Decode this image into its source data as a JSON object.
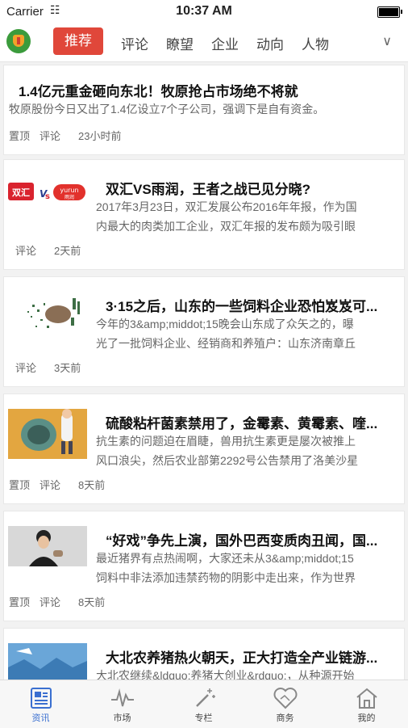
{
  "status": {
    "carrier": "Carrier",
    "time": "10:37 AM"
  },
  "nav": {
    "tabs": [
      {
        "label": "推荐"
      },
      {
        "label": "评论"
      },
      {
        "label": "瞭望"
      },
      {
        "label": "企业"
      },
      {
        "label": "动向"
      },
      {
        "label": "人物"
      }
    ],
    "more_icon": "chevron-down-icon"
  },
  "articles": [
    {
      "title": "1.4亿元重金砸向东北！牧原抢占市场绝不将就",
      "summary_lines": [
        "牧原股份今日又出了1.4亿设立7个子公司，强调下是自有资金。"
      ],
      "tags": [
        "置顶",
        "评论"
      ],
      "time": "23小时前"
    },
    {
      "title": "双汇VS雨润，王者之战已见分晓?",
      "summary_lines": [
        "2017年3月23日，双汇发展公布2016年年报，作为国",
        "内最大的肉类加工企业，双汇年报的发布颇为吸引眼"
      ],
      "tags": [
        "评论"
      ],
      "time": "2天前",
      "image_texts": [
        "双汇",
        "yurun",
        "雨润"
      ]
    },
    {
      "title": "3·15之后，山东的一些饲料企业恐怕岌岌可...",
      "summary_lines": [
        "今年的3&amp;middot;15晚会山东成了众矢之的，曝",
        "光了一批饲料企业、经销商和养殖户：山东济南章丘"
      ],
      "tags": [
        "评论"
      ],
      "time": "3天前"
    },
    {
      "title": "硫酸粘杆菌素禁用了，金霉素、黄霉素、喹...",
      "summary_lines": [
        "抗生素的问题迫在眉睫，兽用抗生素更是屡次被推上",
        "风口浪尖，然后农业部第2292号公告禁用了洛美沙星"
      ],
      "tags": [
        "置顶",
        "评论"
      ],
      "time": "8天前"
    },
    {
      "title": "“好戏”争先上演，国外巴西变质肉丑闻，国...",
      "summary_lines": [
        "最近猪界有点热闹啊，大家还未从3&amp;middot;15",
        "饲料中非法添加违禁药物的阴影中走出来，作为世界"
      ],
      "tags": [
        "置顶",
        "评论"
      ],
      "time": "8天前"
    },
    {
      "title": "大北农养猪热火朝天，正大打造全产业链游...",
      "summary_lines": [
        "大北农继续&ldquo;养猪大创业&rdquo;，从种源开始"
      ],
      "tags": [],
      "time": ""
    }
  ],
  "tabbar": [
    {
      "label": "资讯",
      "icon": "news-icon"
    },
    {
      "label": "市场",
      "icon": "pulse-chart-icon"
    },
    {
      "label": "专栏",
      "icon": "magic-wand-icon"
    },
    {
      "label": "商务",
      "icon": "handshake-icon"
    },
    {
      "label": "我的",
      "icon": "home-icon"
    }
  ],
  "colors": {
    "accent": "#e0473a",
    "tab_active": "#3a6fd0",
    "logo_green": "#3b9b3c"
  }
}
